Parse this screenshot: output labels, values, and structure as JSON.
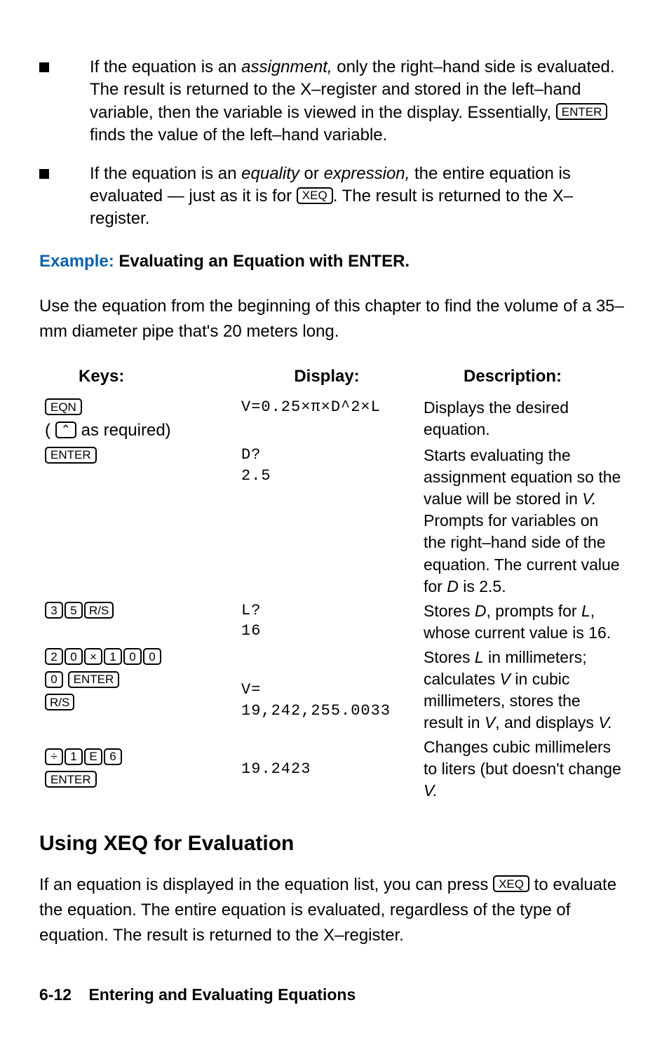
{
  "keys": {
    "enter": "ENTER",
    "xeq": "XEQ",
    "eqn": "EQN",
    "caret": "⌃",
    "rs": "R/S",
    "x": "×",
    "div": "÷",
    "k0": "0",
    "k1": "1",
    "k2": "2",
    "k3": "3",
    "k5": "5",
    "k6": "6",
    "kE": "E"
  },
  "bullets": [
    {
      "pre1": "If the equation is an ",
      "ital1": "assignment,",
      "post1": " only the right–hand side is evaluated. The result is returned to the X–register and stored in the left–hand variable, then the variable is viewed in the display. Essentially, ",
      "post2": " finds the value of the left–hand variable."
    },
    {
      "pre1": "If the equation is an ",
      "ital1": "equality",
      "mid1": " or ",
      "ital2": "expression,",
      "post1": " the entire equation is evaluated — just as it is for ",
      "post2": ". The result is returned to the X–register."
    }
  ],
  "example": {
    "label": "Example:",
    "title": " Evaluating an Equation with ENTER."
  },
  "intro": "Use the equation from the beginning of this chapter to find the volume of a 35–mm diameter pipe that's 20 meters long.",
  "table": {
    "head": {
      "keys": "Keys:",
      "display": "Display:",
      "desc": "Description:"
    },
    "rows": [
      {
        "keys_after": " as required)",
        "display": "V=0.25×π×D^2×L",
        "desc": "Displays the desired equation."
      },
      {
        "display1": "D?",
        "display2": "2.5",
        "desc_a": "Starts evaluating the assignment equation so the value will be stored in ",
        "desc_v": "V.",
        "desc_b": " Prompts for variables on the right–hand side of the equation. The current value for ",
        "desc_d": "D",
        "desc_c": " is 2.5."
      },
      {
        "display1": "L?",
        "display2": "16",
        "desc_a": "Stores ",
        "desc_d": "D",
        "desc_b": ", prompts for ",
        "desc_l": "L",
        "desc_c": ", whose current value is 16."
      },
      {
        "display1": "V=",
        "display2": "19,242,255.0033",
        "desc_a": "Stores ",
        "desc_l": "L",
        "desc_b": " in millimeters; calculates ",
        "desc_v": "V",
        "desc_c": " in cubic millimeters, stores the result in ",
        "desc_v2": "V",
        "desc_d": ", and displays ",
        "desc_v3": "V."
      },
      {
        "display1": "19.2423",
        "desc_a": "Changes cubic millimelers to liters (but doesn't change ",
        "desc_v": "V."
      }
    ]
  },
  "sect": "Using XEQ for Evaluation",
  "para2_a": "If an equation is displayed in the equation list, you can press ",
  "para2_b": " to evaluate the equation. The entire equation is evaluated, regardless of the type of equation. The result is returned to the X–register.",
  "footer": {
    "page": "6-12",
    "chapter": "Entering and Evaluating Equations"
  }
}
